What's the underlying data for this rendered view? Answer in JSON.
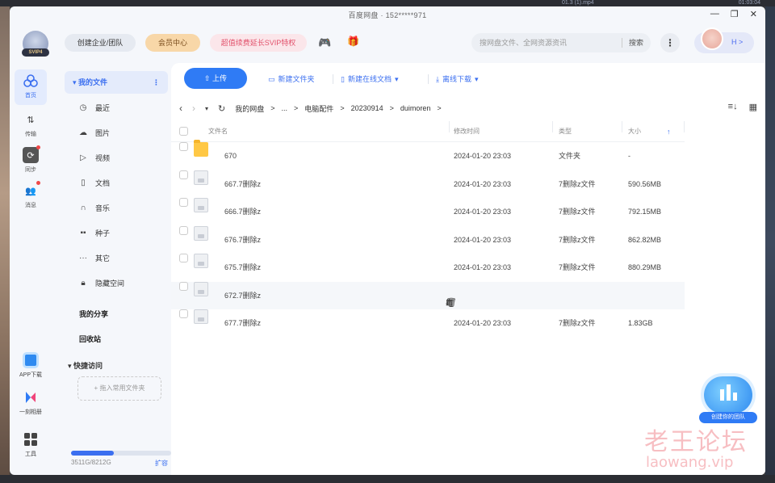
{
  "window": {
    "title": "百度网盘 · 152*****971",
    "controls": [
      "—",
      "❐",
      "✕"
    ]
  },
  "header": {
    "logo_badge": "SVIP4",
    "create_business": "创建企业/团队",
    "member_center": "会员中心",
    "promo": "超值续费延长SVIP特权",
    "search_placeholder": "搜网盘文件、全网资源资讯",
    "search_button": "搜索",
    "avatar_badge": "H >"
  },
  "rail": {
    "items": [
      {
        "label": "首页",
        "icon": "home-icon"
      },
      {
        "label": "传输",
        "icon": "transfer-icon"
      },
      {
        "label": "同步",
        "icon": "sync-icon"
      },
      {
        "label": "消息",
        "icon": "message-icon"
      }
    ],
    "bottom": [
      {
        "label": "APP下载",
        "icon": "phone-icon"
      },
      {
        "label": "一刻相册",
        "icon": "album-icon"
      },
      {
        "label": "工具",
        "icon": "tools-icon"
      }
    ]
  },
  "sidebar": {
    "my_files": "我的文件",
    "items": [
      {
        "label": "最近",
        "icon": "clock-icon"
      },
      {
        "label": "图片",
        "icon": "image-icon"
      },
      {
        "label": "视频",
        "icon": "video-icon"
      },
      {
        "label": "文档",
        "icon": "document-icon"
      },
      {
        "label": "音乐",
        "icon": "headphone-icon"
      },
      {
        "label": "种子",
        "icon": "seed-icon"
      },
      {
        "label": "其它",
        "icon": "more-icon"
      },
      {
        "label": "隐藏空间",
        "icon": "lock-icon"
      }
    ],
    "my_share": "我的分享",
    "recycle": "回收站",
    "quick_access": "快捷访问",
    "drop_hint": "+ 拖入常用文件夹",
    "quota_text": "3511G/8212G",
    "quota_fraction": 0.43,
    "expand": "扩容"
  },
  "toolbar": {
    "upload": "上传",
    "new_folder": "新建文件夹",
    "new_online_doc": "新建在线文档",
    "offline_download": "离线下载"
  },
  "path": {
    "crumbs": [
      "我的网盘",
      ">",
      "...",
      ">",
      "电脑配件",
      ">",
      "20230914",
      ">",
      "duimoren",
      ">"
    ]
  },
  "table": {
    "headers": {
      "name": "文件名",
      "modified": "修改时间",
      "type": "类型",
      "size": "大小"
    },
    "rows": [
      {
        "name": "670",
        "modified": "2024-01-20 23:03",
        "type": "文件夹",
        "size": "-",
        "kind": "folder"
      },
      {
        "name": "667.7删除z",
        "modified": "2024-01-20 23:03",
        "type": "7删除z文件",
        "size": "590.56MB",
        "kind": "file"
      },
      {
        "name": "666.7删除z",
        "modified": "2024-01-20 23:03",
        "type": "7删除z文件",
        "size": "792.15MB",
        "kind": "file"
      },
      {
        "name": "676.7删除z",
        "modified": "2024-01-20 23:03",
        "type": "7删除z文件",
        "size": "862.82MB",
        "kind": "file"
      },
      {
        "name": "675.7删除z",
        "modified": "2024-01-20 23:03",
        "type": "7删除z文件",
        "size": "880.29MB",
        "kind": "file"
      },
      {
        "name": "672.7删除z",
        "modified": "",
        "type": "",
        "size": "",
        "kind": "file"
      },
      {
        "name": "677.7删除z",
        "modified": "2024-01-20 23:03",
        "type": "7删除z文件",
        "size": "1.83GB",
        "kind": "file"
      }
    ]
  },
  "floating": {
    "cloud_label": "创建你的团队"
  },
  "watermark": {
    "text": "老王论坛",
    "url": "laowang.vip"
  },
  "background": {
    "video_top_left": "01.3 (1).mp4",
    "video_top_right": "01:03:04"
  }
}
